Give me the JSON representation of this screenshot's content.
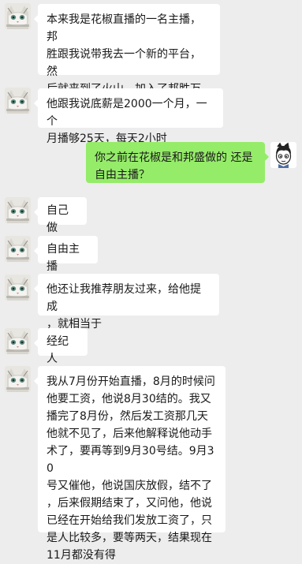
{
  "messages": [
    {
      "side": "in",
      "text": "本来我是花椒直播的一名主播，邦\n胜跟我说带我去一个新的平台，然\n后就来到了火山，加入了邦胜万合\n家族。"
    },
    {
      "side": "in",
      "text": "他跟我说底薪是2000一个月，一个\n月播够25天，每天2小时"
    },
    {
      "side": "out",
      "text": "你之前在花椒是和邦盛做的  还是\n自由主播？"
    },
    {
      "side": "in",
      "text": "自己做"
    },
    {
      "side": "in",
      "text": "自由主播"
    },
    {
      "side": "in",
      "text": "他还让我推荐朋友过来，给他提成\n，就相当于"
    },
    {
      "side": "in",
      "text": "经纪人"
    },
    {
      "side": "in",
      "text": "我从7月份开始直播，8月的时候问\n他要工资，他说8月30结的。我又\n播完了8月份，然后发工资那几天\n他就不见了，后来他解释说他动手\n术了，要再等到9月30号结。9月30\n号又催他，他说国庆放假，结不了\n，后来假期结束了，又问他，他说\n已经在开始给我们发放工资了，只\n是人比较多，要等两天，结果现在\n11月都没有得"
    }
  ],
  "colors": {
    "background": "#ededed",
    "incoming_bubble": "#ffffff",
    "outgoing_bubble": "#95ec69"
  },
  "avatars": {
    "incoming": "cat-avatar-icon",
    "outgoing": "cartoon-boy-avatar-icon"
  }
}
